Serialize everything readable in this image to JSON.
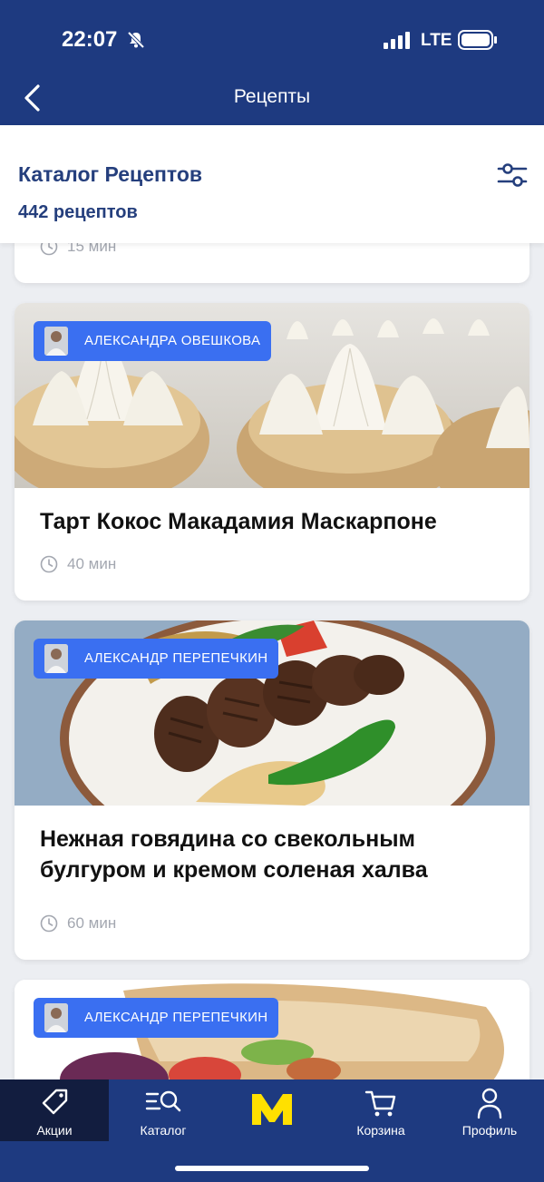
{
  "status": {
    "time": "22:07",
    "network": "LTE"
  },
  "nav": {
    "title": "Рецепты"
  },
  "catalog": {
    "title": "Каталог Рецептов",
    "count": "442 рецептов"
  },
  "recipes": [
    {
      "title": "",
      "time": "15 мин"
    },
    {
      "author": "АЛЕКСАНДРА ОВЕШКОВА",
      "title": "Тарт Кокос Макадамия Маскарпоне",
      "time": "40 мин"
    },
    {
      "author": "АЛЕКСАНДР ПЕРЕПЕЧКИН",
      "title": "Нежная говядина со свекольным булгуром и кремом соленая халва",
      "time": "60 мин"
    },
    {
      "author": "АЛЕКСАНДР ПЕРЕПЕЧКИН",
      "title": "",
      "time": ""
    }
  ],
  "tabs": [
    {
      "label": "Акции",
      "icon": "tag-icon",
      "active": true
    },
    {
      "label": "Каталог",
      "icon": "catalog-search-icon",
      "active": false
    },
    {
      "label": "",
      "icon": "metro-logo-icon",
      "active": false
    },
    {
      "label": "Корзина",
      "icon": "cart-icon",
      "active": false
    },
    {
      "label": "Профиль",
      "icon": "profile-icon",
      "active": false
    }
  ],
  "colors": {
    "brand": "#1e3a80",
    "accent": "#3a6ff1",
    "logo": "#ffe000",
    "heading": "#253f7d"
  }
}
